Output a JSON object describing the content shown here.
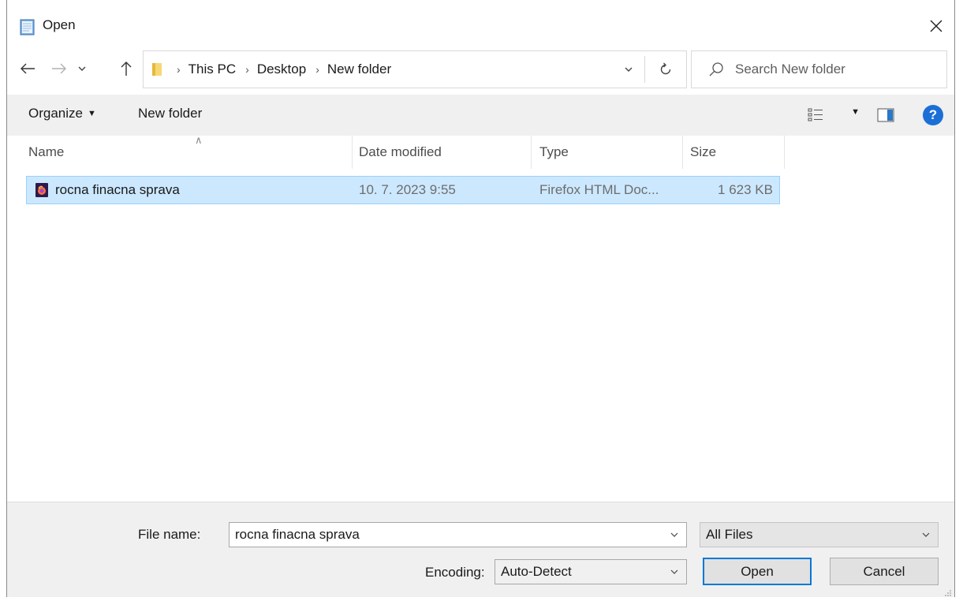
{
  "window": {
    "title": "Open"
  },
  "nav": {
    "breadcrumbs": [
      "This PC",
      "Desktop",
      "New folder"
    ],
    "search_placeholder": "Search New folder"
  },
  "toolbar": {
    "organize_label": "Organize",
    "new_folder_label": "New folder"
  },
  "columns": {
    "name": "Name",
    "date_modified": "Date modified",
    "type": "Type",
    "size": "Size"
  },
  "files": [
    {
      "name": "rocna finacna sprava",
      "date_modified": "10. 7. 2023 9:55",
      "type": "Firefox HTML Doc...",
      "size": "1 623 KB",
      "selected": true
    }
  ],
  "bottom": {
    "file_name_label": "File name:",
    "file_name_value": "rocna finacna sprava",
    "filter_value": "All Files",
    "encoding_label": "Encoding:",
    "encoding_value": "Auto-Detect",
    "open_label": "Open",
    "cancel_label": "Cancel"
  },
  "colors": {
    "selection_bg": "#cce8ff",
    "selection_border": "#99d1ff",
    "accent": "#0078d7",
    "help": "#1b6fd6"
  }
}
